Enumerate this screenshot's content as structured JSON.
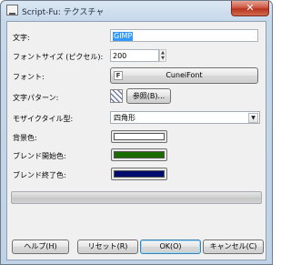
{
  "window": {
    "title": "Script-Fu: テクスチャ",
    "close_glyph": "✕"
  },
  "fields": {
    "text": {
      "label": "文字:",
      "value": "GIMP"
    },
    "font_size": {
      "label": "フォントサイズ (ピクセル):",
      "value": "200"
    },
    "font": {
      "label": "フォント:",
      "value": "CuneiFont",
      "icon": "font-icon"
    },
    "text_pattern": {
      "label": "文字パターン:",
      "browse_label": "参照(B)..."
    },
    "mosaic": {
      "label": "モザイクタイル型:",
      "value": "四角形"
    },
    "background": {
      "label": "背景色:",
      "color": "#ffffff"
    },
    "blend_start": {
      "label": "ブレンド開始色:",
      "color": "#1a6b00"
    },
    "blend_end": {
      "label": "ブレンド終了色:",
      "color": "#000a6c"
    }
  },
  "progress": {
    "value": 0
  },
  "buttons": {
    "help": "ヘルプ(H)",
    "reset": "リセット(R)",
    "ok": "OK(O)",
    "cancel": "キャンセル(C)"
  }
}
